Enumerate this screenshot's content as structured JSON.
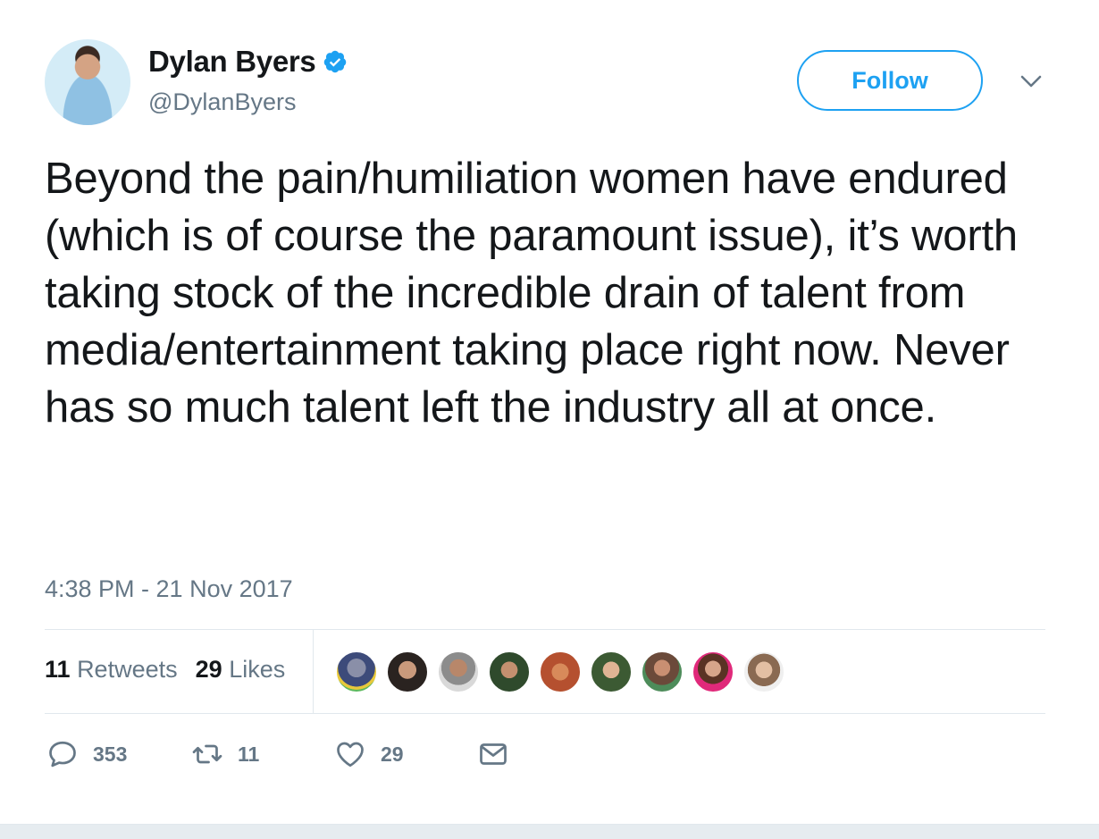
{
  "author": {
    "display_name": "Dylan Byers",
    "handle": "@DylanByers",
    "verified": true
  },
  "follow_label": "Follow",
  "tweet_text": "Beyond the pain/humiliation women have endured (which is of course the paramount issue), it’s worth taking stock of the incredible drain of talent from media/entertainment taking place right now. Never has so much talent left the industry all at once.",
  "timestamp": "4:38 PM - 21 Nov 2017",
  "stats": {
    "retweets_count": "11",
    "retweets_label": "Retweets",
    "likes_count": "29",
    "likes_label": "Likes"
  },
  "actions": {
    "reply_count": "353",
    "retweet_count": "11",
    "like_count": "29"
  },
  "colors": {
    "accent": "#1da1f2",
    "secondary_text": "#657786",
    "divider": "#e1e8ed"
  }
}
